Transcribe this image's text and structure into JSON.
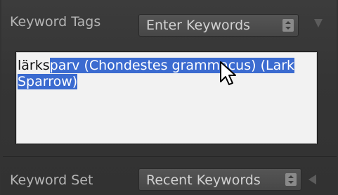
{
  "keyword_tags": {
    "label": "Keyword Tags",
    "mode_select": "Enter Keywords",
    "text_unselected": "lärks",
    "text_selected": "parv (Chondestes grammacus) (Lark Sparrow)"
  },
  "keyword_set": {
    "label": "Keyword Set",
    "set_select": "Recent Keywords"
  },
  "colors": {
    "panel": "#353535",
    "selection": "#3b6bd0",
    "editor_bg": "#f2f2f2"
  },
  "icons": [
    "stepper-icon",
    "disclosure-triangle-down-icon",
    "mouse-pointer-icon",
    "disclosure-triangle-left-icon"
  ]
}
